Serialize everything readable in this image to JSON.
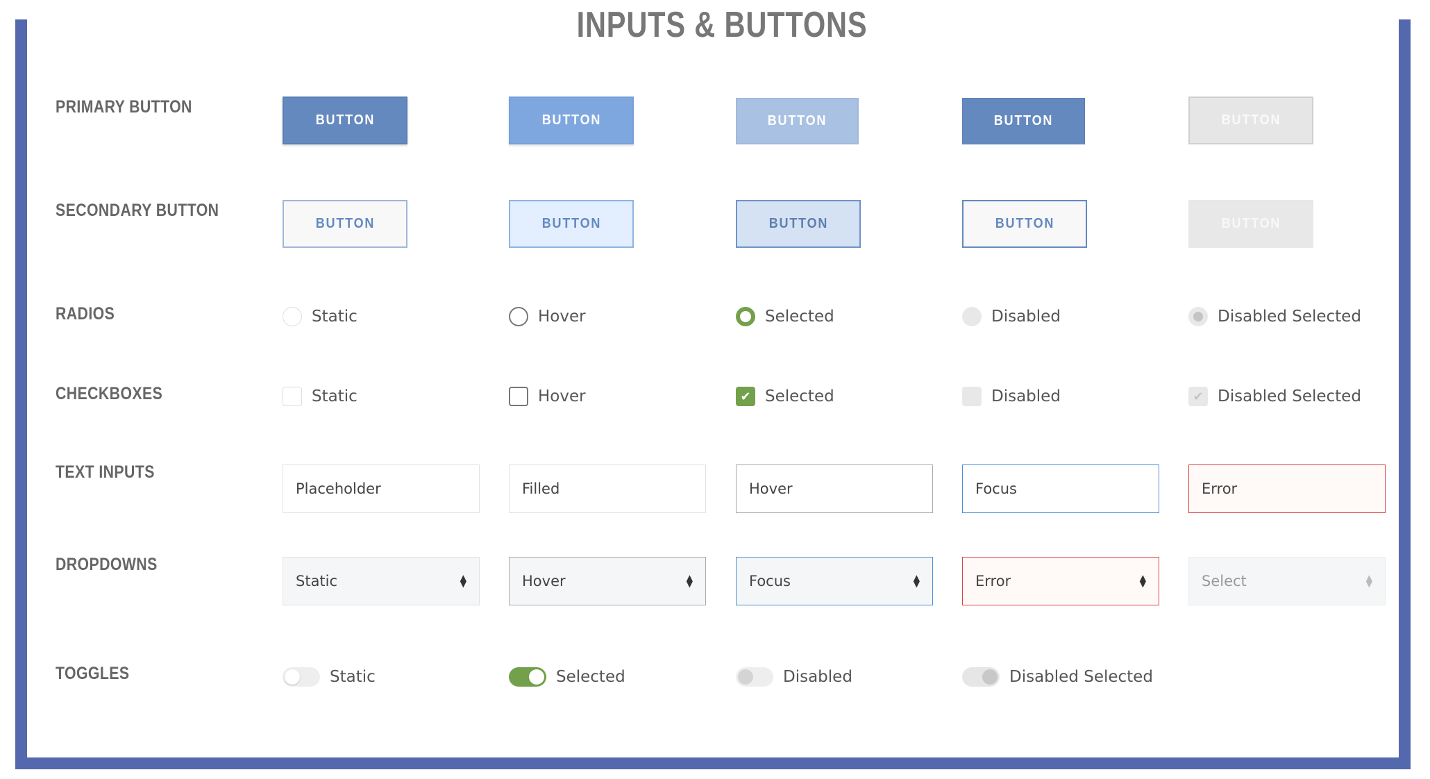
{
  "title": "INPUTS & BUTTONS",
  "colors": {
    "frame": "#5469ad",
    "primary": "#6489bf",
    "primary_hover": "#7fa7df",
    "primary_pressed": "#a9c1e2",
    "success_green": "#72a04b",
    "error_red": "#d64545",
    "focus_blue": "#4a90d9"
  },
  "rows": {
    "primary_button": {
      "label": "PRIMARY BUTTON",
      "items": [
        "BUTTON",
        "BUTTON",
        "BUTTON",
        "BUTTON",
        "BUTTON"
      ]
    },
    "secondary_button": {
      "label": "SECONDARY BUTTON",
      "items": [
        "BUTTON",
        "BUTTON",
        "BUTTON",
        "BUTTON",
        "BUTTON"
      ]
    },
    "radios": {
      "label": "RADIOS",
      "items": [
        "Static",
        "Hover",
        "Selected",
        "Disabled",
        "Disabled Selected"
      ]
    },
    "checkboxes": {
      "label": "CHECKBOXES",
      "items": [
        "Static",
        "Hover",
        "Selected",
        "Disabled",
        "Disabled Selected"
      ]
    },
    "text_inputs": {
      "label": "TEXT INPUTS",
      "items": [
        "Placeholder",
        "Filled",
        "Hover",
        "Focus",
        "Error"
      ]
    },
    "dropdowns": {
      "label": "DROPDOWNS",
      "items": [
        "Static",
        "Hover",
        "Focus",
        "Error",
        "Select"
      ]
    },
    "toggles": {
      "label": "TOGGLES",
      "items": [
        "Static",
        "Selected",
        "Disabled",
        "Disabled Selected"
      ]
    }
  },
  "icons": {
    "checkmark": "check-icon",
    "dropdown_arrows": "up-down-caret-icon"
  }
}
